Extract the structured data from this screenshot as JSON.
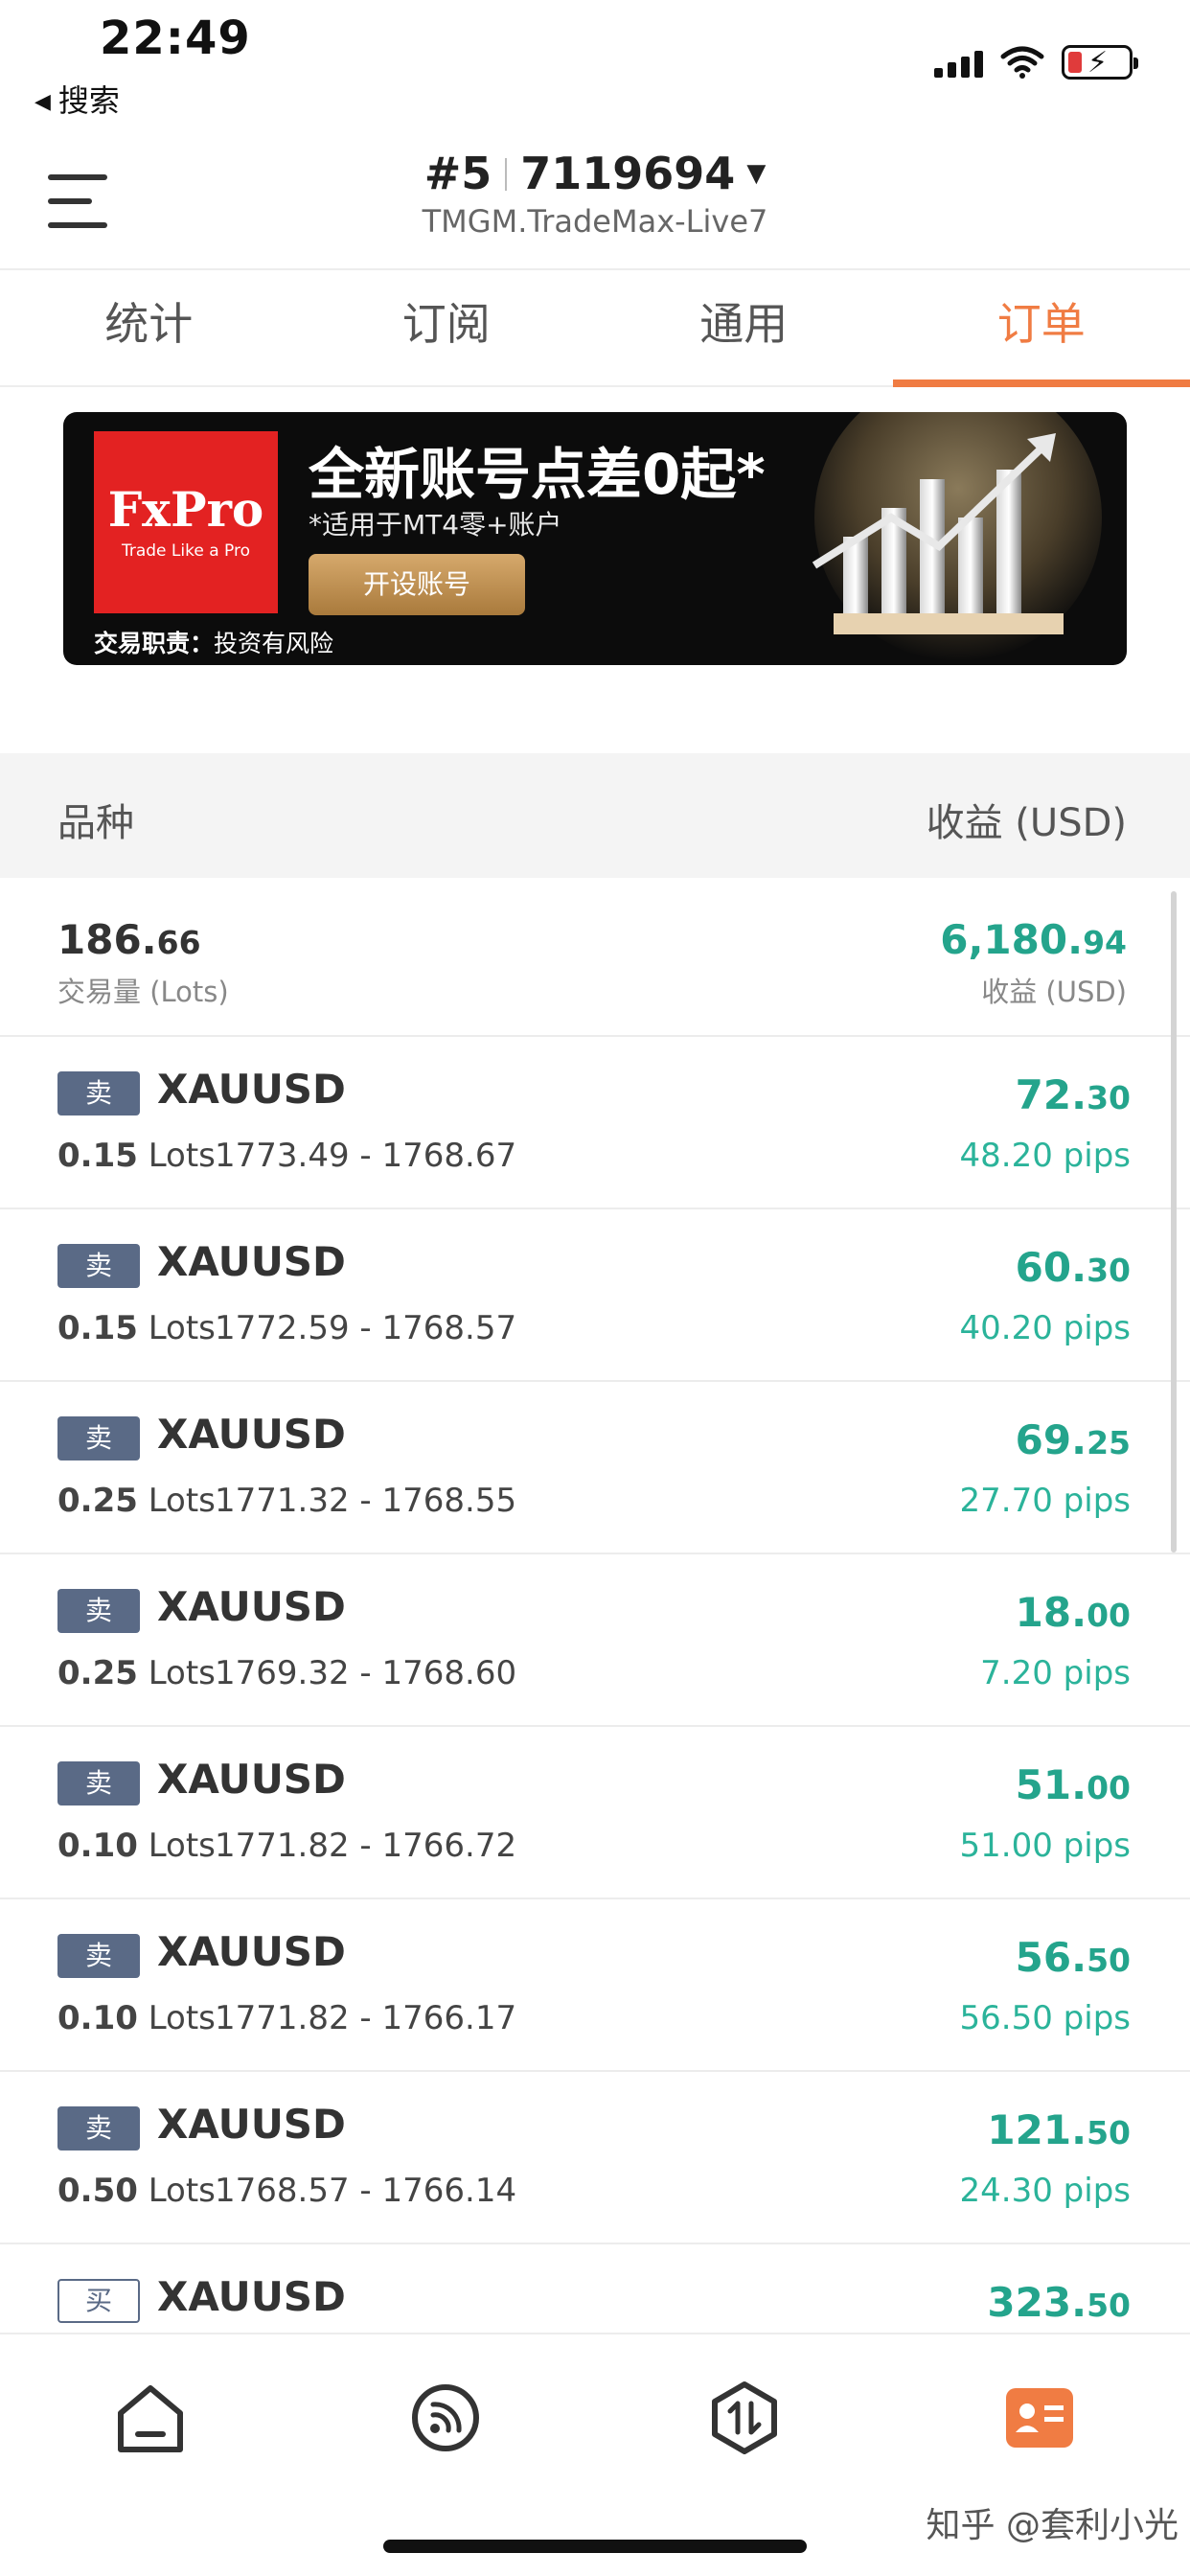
{
  "status_bar": {
    "time": "22:49",
    "back_label": "搜索",
    "back_icon": "back-triangle-icon"
  },
  "header": {
    "account_number": "#5",
    "account_id": "7119694",
    "server": "TMGM.TradeMax-Live7"
  },
  "tabs": [
    {
      "label": "统计",
      "active": false
    },
    {
      "label": "订阅",
      "active": false
    },
    {
      "label": "通用",
      "active": false
    },
    {
      "label": "订单",
      "active": true
    }
  ],
  "banner": {
    "brand": "FxPro",
    "brand_tagline": "Trade Like a Pro",
    "headline": "全新账号点差0起*",
    "subline": "*适用于MT4零+账户",
    "button_label": "开设账号",
    "risk_label": "交易职责：",
    "risk_text": "投资有风险"
  },
  "table_header": {
    "left": "品种",
    "right": "收益 (USD)"
  },
  "summary": {
    "volume_int": "186.",
    "volume_dec": "66",
    "volume_label": "交易量 (Lots)",
    "profit_int": "6,180.",
    "profit_dec": "94",
    "profit_label": "收益 (USD)"
  },
  "orders": [
    {
      "side": "卖",
      "symbol": "XAUUSD",
      "lots": "0.15",
      "lots_unit": "Lots",
      "prices": "1773.49 - 1768.67",
      "profit_int": "72.",
      "profit_dec": "30",
      "pips": "48.20 pips"
    },
    {
      "side": "卖",
      "symbol": "XAUUSD",
      "lots": "0.15",
      "lots_unit": "Lots",
      "prices": "1772.59 - 1768.57",
      "profit_int": "60.",
      "profit_dec": "30",
      "pips": "40.20 pips"
    },
    {
      "side": "卖",
      "symbol": "XAUUSD",
      "lots": "0.25",
      "lots_unit": "Lots",
      "prices": "1771.32 - 1768.55",
      "profit_int": "69.",
      "profit_dec": "25",
      "pips": "27.70 pips"
    },
    {
      "side": "卖",
      "symbol": "XAUUSD",
      "lots": "0.25",
      "lots_unit": "Lots",
      "prices": "1769.32 - 1768.60",
      "profit_int": "18.",
      "profit_dec": "00",
      "pips": "7.20 pips"
    },
    {
      "side": "卖",
      "symbol": "XAUUSD",
      "lots": "0.10",
      "lots_unit": "Lots",
      "prices": "1771.82 - 1766.72",
      "profit_int": "51.",
      "profit_dec": "00",
      "pips": "51.00 pips"
    },
    {
      "side": "卖",
      "symbol": "XAUUSD",
      "lots": "0.10",
      "lots_unit": "Lots",
      "prices": "1771.82 - 1766.17",
      "profit_int": "56.",
      "profit_dec": "50",
      "pips": "56.50 pips"
    },
    {
      "side": "卖",
      "symbol": "XAUUSD",
      "lots": "0.50",
      "lots_unit": "Lots",
      "prices": "1768.57 - 1766.14",
      "profit_int": "121.",
      "profit_dec": "50",
      "pips": "24.30 pips"
    },
    {
      "side": "买",
      "symbol": "XAUUSD",
      "lots": "",
      "lots_unit": "",
      "prices": "",
      "profit_int": "323.",
      "profit_dec": "50",
      "pips": ""
    }
  ],
  "bottom_nav": [
    {
      "icon": "home-icon",
      "active": false
    },
    {
      "icon": "signal-feed-icon",
      "active": false
    },
    {
      "icon": "trade-arrows-icon",
      "active": false
    },
    {
      "icon": "account-card-icon",
      "active": true
    }
  ],
  "watermark": "知乎 @套利小光",
  "colors": {
    "accent": "#f07c43",
    "profit": "#24a48c",
    "sell_badge": "#5a6a86"
  }
}
